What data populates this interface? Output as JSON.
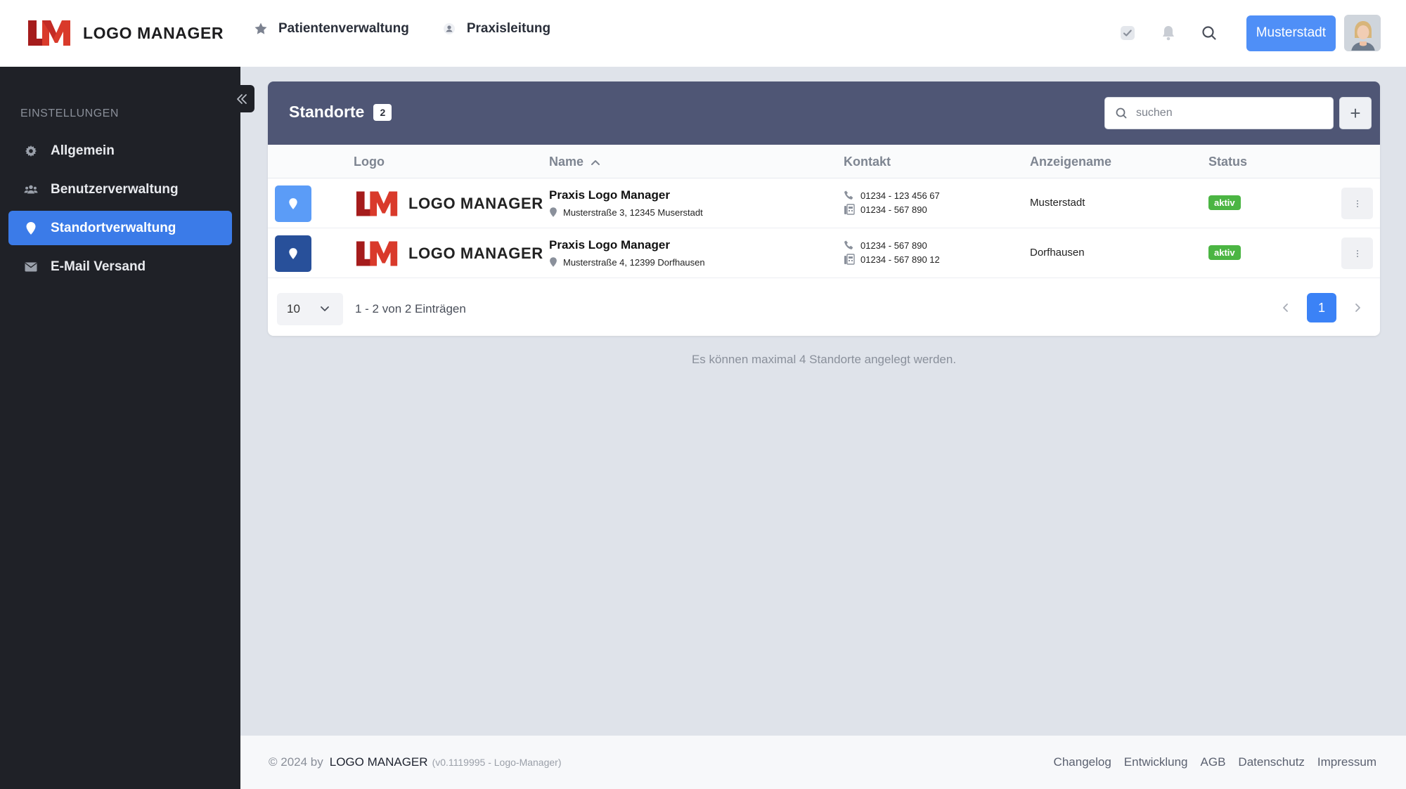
{
  "app": {
    "brand_name": "LOGO MANAGER",
    "brand_mark_text": "LM",
    "brand_colors": {
      "dark_red": "#a51c1c",
      "red": "#d93a2b"
    }
  },
  "topnav": [
    {
      "label": "Patientenverwaltung",
      "icon": "star-icon"
    },
    {
      "label": "Praxisleitung",
      "icon": "user-icon"
    }
  ],
  "topright": {
    "icons": [
      "check-icon",
      "bell-icon",
      "search-icon"
    ],
    "location_button": "Musterstadt",
    "accent": "#4f8ff7"
  },
  "sidebar": {
    "section": "EINSTELLUNGEN",
    "items": [
      {
        "label": "Allgemein",
        "icon": "gear-icon",
        "active": false
      },
      {
        "label": "Benutzerverwaltung",
        "icon": "users-icon",
        "active": false
      },
      {
        "label": "Standortverwaltung",
        "icon": "map-pin-icon",
        "active": true
      },
      {
        "label": "E-Mail Versand",
        "icon": "envelope-icon",
        "active": false
      }
    ]
  },
  "card": {
    "title": "Standorte",
    "count": "2",
    "search_placeholder": "suchen",
    "add_label": "+",
    "columns": [
      "Logo",
      "Name",
      "Kontakt",
      "Anzeigename",
      "Status"
    ],
    "rows": [
      {
        "pin_color": "#5b9cf7",
        "logo_text": "LOGO MANAGER",
        "name": "Praxis Logo Manager",
        "address": "Musterstraße 3, 12345 Muserstadt",
        "phone": "01234 - 123 456 67",
        "fax": "01234 - 567 890",
        "display_name": "Musterstadt",
        "status": "aktiv"
      },
      {
        "pin_color": "#28509a",
        "logo_text": "LOGO MANAGER",
        "name": "Praxis Logo Manager",
        "address": "Musterstraße 4, 12399 Dorfhausen",
        "phone": "01234 - 567 890",
        "fax": "01234 - 567 890 12",
        "display_name": "Dorfhausen",
        "status": "aktiv"
      }
    ],
    "page_size": "10",
    "range_text": "1 - 2 von 2 Einträgen",
    "current_page": "1"
  },
  "hint": "Es können maximal 4 Standorte angelegt werden.",
  "footer": {
    "copyright": "© 2024 by",
    "brand": "LOGO MANAGER",
    "version": "(v0.1119995 - Logo-Manager)",
    "links": [
      "Changelog",
      "Entwicklung",
      "AGB",
      "Datenschutz",
      "Impressum"
    ]
  }
}
